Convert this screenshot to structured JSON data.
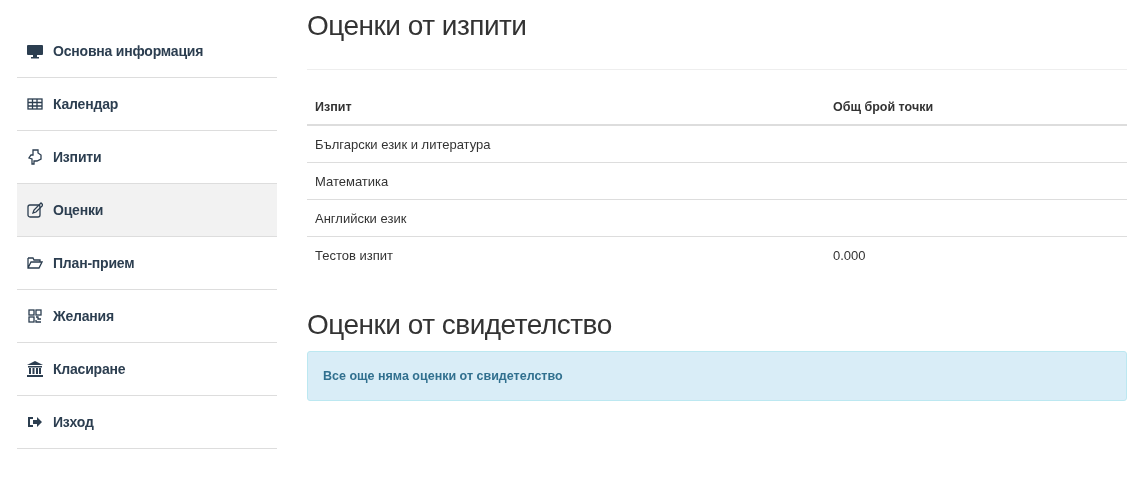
{
  "sidebar": {
    "items": [
      {
        "label": "Основна информация",
        "selected": false
      },
      {
        "label": "Календар",
        "selected": false
      },
      {
        "label": "Изпити",
        "selected": false
      },
      {
        "label": "Оценки",
        "selected": true
      },
      {
        "label": "План-прием",
        "selected": false
      },
      {
        "label": "Желания",
        "selected": false
      },
      {
        "label": "Класиране",
        "selected": false
      },
      {
        "label": "Изход",
        "selected": false
      }
    ]
  },
  "exams": {
    "title": "Оценки от изпити",
    "columns": [
      "Изпит",
      "Общ брой точки"
    ],
    "rows": [
      {
        "exam": "Български език и литература",
        "points": ""
      },
      {
        "exam": "Математика",
        "points": ""
      },
      {
        "exam": "Английски език",
        "points": ""
      },
      {
        "exam": "Тестов изпит",
        "points": "0.000"
      }
    ]
  },
  "certificate": {
    "title": "Оценки от свидетелство",
    "notice": "Все още няма оценки от свидетелство"
  }
}
